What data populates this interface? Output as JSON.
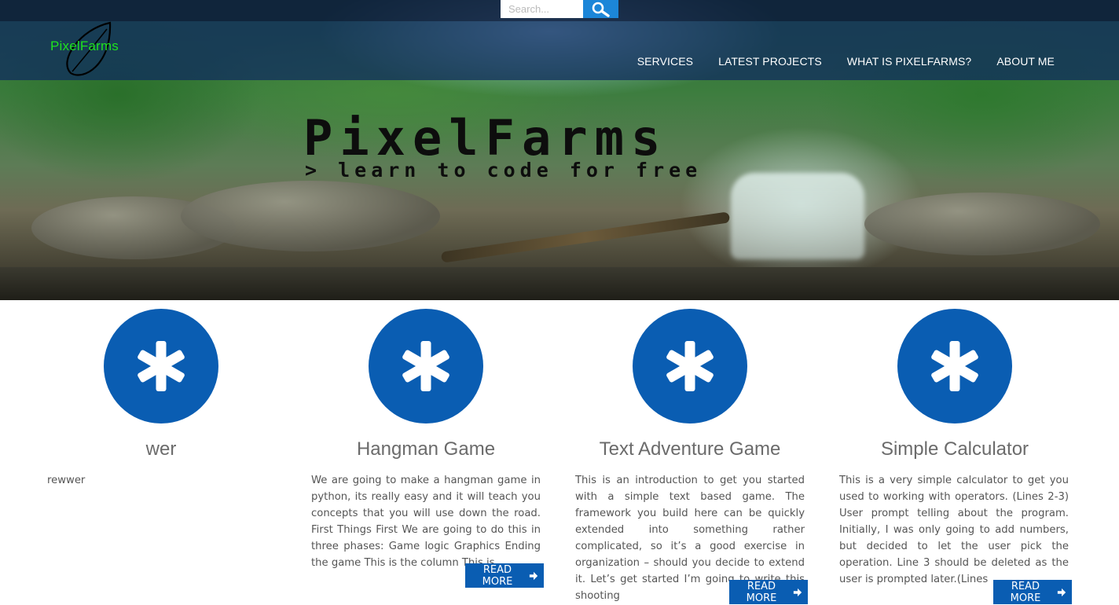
{
  "search": {
    "placeholder": "Search..."
  },
  "logo": {
    "text": "PixelFarms"
  },
  "nav": {
    "items": [
      {
        "label": "SERVICES"
      },
      {
        "label": "LATEST PROJECTS"
      },
      {
        "label": "WHAT IS PIXELFARMS?"
      },
      {
        "label": "ABOUT ME"
      }
    ]
  },
  "hero": {
    "title": "PixelFarms",
    "subtitle": "> learn to code for free"
  },
  "cards": [
    {
      "icon": "asterisk-icon",
      "title": "wer",
      "text": "rewwer",
      "button": ""
    },
    {
      "icon": "asterisk-icon",
      "title": "Hangman Game",
      "text": "We are going to make a hangman game in python, its really easy and it will teach you concepts that you will use down the road. First Things First We are going to do this in three phases: Game logic Graphics Ending the game This is the column This is",
      "button": "READ MORE"
    },
    {
      "icon": "asterisk-icon",
      "title": "Text Adventure Game",
      "text": "This is an introduction to get you started with a simple text based game. The framework you build here can be quickly extended into something rather complicated, so it’s a good exercise in organization – should you decide to extend it. Let’s get started I’m going to write this shooting",
      "button": "READ MORE"
    },
    {
      "icon": "asterisk-icon",
      "title": "Simple Calculator",
      "text": "This is a very simple calculator to get you used to working with operators. (Lines 2-3) User prompt telling about the program. Initially, I was only going to add numbers, but decided to let the user pick the operation. Line 3 should be deleted as the user is prompted later.(Lines",
      "button": "READ MORE"
    }
  ],
  "colors": {
    "accent": "#0a5db2",
    "logo": "#1fe21f",
    "search_button": "#1c86d8"
  }
}
